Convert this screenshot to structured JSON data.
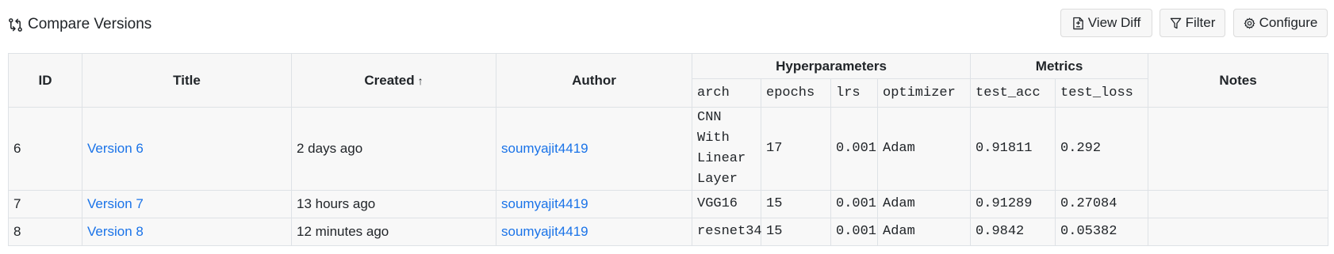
{
  "header": {
    "title": "Compare Versions",
    "buttons": {
      "view_diff": "View Diff",
      "filter": "Filter",
      "configure": "Configure"
    }
  },
  "table": {
    "columns": {
      "id": "ID",
      "title": "Title",
      "created": "Created",
      "created_sort": "↑",
      "author": "Author",
      "hyperparameters": "Hyperparameters",
      "metrics": "Metrics",
      "notes": "Notes"
    },
    "hyperparameter_columns": [
      "arch",
      "epochs",
      "lrs",
      "optimizer"
    ],
    "metric_columns": [
      "test_acc",
      "test_loss"
    ],
    "rows": [
      {
        "id": "6",
        "title": "Version 6",
        "created": "2 days ago",
        "author": "soumyajit4419",
        "arch_lines": [
          "CNN With",
          "Linear",
          "Layer"
        ],
        "epochs": "17",
        "lrs": "0.001",
        "optimizer": "Adam",
        "test_acc": "0.91811",
        "test_loss": "0.292",
        "notes": ""
      },
      {
        "id": "7",
        "title": "Version 7",
        "created": "13 hours ago",
        "author": "soumyajit4419",
        "arch_lines": [
          "VGG16"
        ],
        "epochs": "15",
        "lrs": "0.001",
        "optimizer": "Adam",
        "test_acc": "0.91289",
        "test_loss": "0.27084",
        "notes": ""
      },
      {
        "id": "8",
        "title": "Version 8",
        "created": "12 minutes ago",
        "author": "soumyajit4419",
        "arch_lines": [
          "resnet34"
        ],
        "epochs": "15",
        "lrs": "0.001",
        "optimizer": "Adam",
        "test_acc": "0.9842",
        "test_loss": "0.05382",
        "notes": ""
      }
    ]
  },
  "icons": {
    "compare": "compare-arrows-icon",
    "view_diff": "file-diff-icon",
    "filter": "funnel-icon",
    "configure": "gear-icon"
  },
  "colors": {
    "link": "#1a73e8",
    "header_bg": "#f7f7f7",
    "border": "#dee2e6"
  }
}
